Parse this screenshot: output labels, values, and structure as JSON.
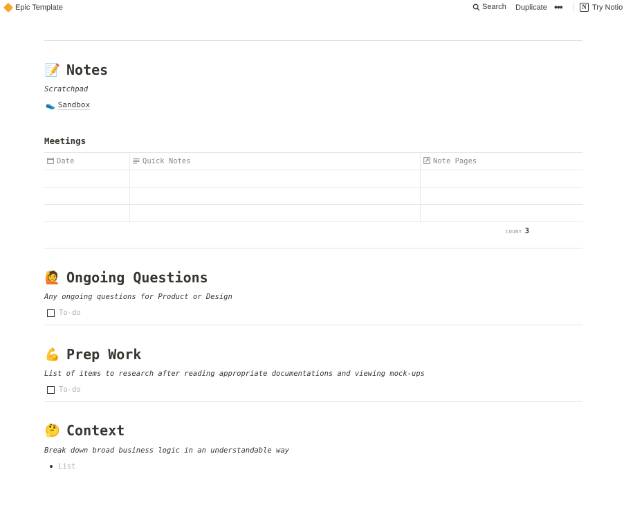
{
  "topbar": {
    "breadcrumb": "Epic Template",
    "search_label": "Search",
    "duplicate_label": "Duplicate",
    "more_label": "•••",
    "try_label": "Try Notio",
    "logo_letter": "N"
  },
  "notes": {
    "icon": "📝",
    "title": "Notes",
    "subtitle": "Scratchpad",
    "sandbox_icon": "👟",
    "sandbox_label": "Sandbox"
  },
  "meetings": {
    "title": "Meetings",
    "columns": [
      {
        "icon": "📅",
        "label": "Date"
      },
      {
        "icon": "≡",
        "label": "Quick Notes"
      },
      {
        "icon": "📄",
        "label": "Note Pages"
      }
    ],
    "rows": [
      [
        "",
        "",
        ""
      ],
      [
        "",
        "",
        ""
      ],
      [
        "",
        "",
        ""
      ]
    ],
    "count_label": "COUNT",
    "count_value": "3"
  },
  "ongoing": {
    "icon": "🙋",
    "title": "Ongoing Questions",
    "desc": "Any ongoing questions for Product or Design",
    "todo_placeholder": "To-do"
  },
  "prep": {
    "icon": "💪",
    "title": "Prep Work",
    "desc": "List of items to research after reading appropriate documentations and viewing mock-ups",
    "todo_placeholder": "To-do"
  },
  "context": {
    "icon": "🤔",
    "title": "Context",
    "desc": "Break down broad business logic in an understandable way",
    "list_placeholder": "List"
  }
}
